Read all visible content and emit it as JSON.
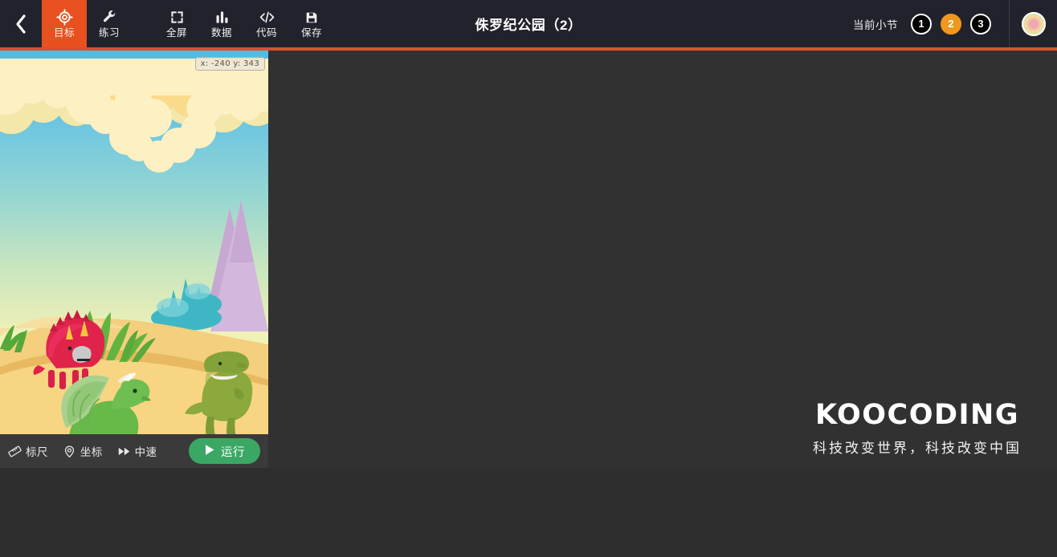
{
  "header": {
    "back_icon": "chevron-left-icon",
    "title": "侏罗纪公园（2）",
    "tools": [
      {
        "label": "目标",
        "icon": "target-icon",
        "active": true
      },
      {
        "label": "练习",
        "icon": "wrench-icon",
        "active": false
      },
      {
        "label": "全屏",
        "icon": "fullscreen-icon",
        "active": false
      },
      {
        "label": "数据",
        "icon": "bar-chart-icon",
        "active": false
      },
      {
        "label": "代码",
        "icon": "code-icon",
        "active": false
      },
      {
        "label": "保存",
        "icon": "save-icon",
        "active": false
      }
    ],
    "section_label": "当前小节",
    "sections": [
      {
        "number": "1",
        "current": false
      },
      {
        "number": "2",
        "current": true
      },
      {
        "number": "3",
        "current": false
      }
    ],
    "avatar_icon": "user-avatar-icon"
  },
  "stage": {
    "coordinates": "x: -240 y: 343",
    "toolbar": [
      {
        "label": "标尺",
        "icon": "ruler-icon"
      },
      {
        "label": "坐标",
        "icon": "location-pin-icon"
      },
      {
        "label": "中速",
        "icon": "fast-forward-icon"
      }
    ],
    "run_button": {
      "label": "运行",
      "icon": "play-icon"
    },
    "scene": {
      "description": "jurassic-park-desert-scene",
      "sprites": [
        "red-triceratops",
        "green-dragon",
        "olive-tyrannosaurus"
      ]
    }
  },
  "workspace": {
    "watermark_title": "KOOCODING",
    "watermark_subtitle": "科技改变世界，科技改变中国"
  },
  "colors": {
    "header_bg": "#22222c",
    "accent_orange": "#e8511f",
    "divider_orange": "#d9512c",
    "current_chip": "#f0971e",
    "run_green": "#3aa864",
    "workspace_bg": "#313131",
    "panel_bg": "#3a3a3a"
  }
}
